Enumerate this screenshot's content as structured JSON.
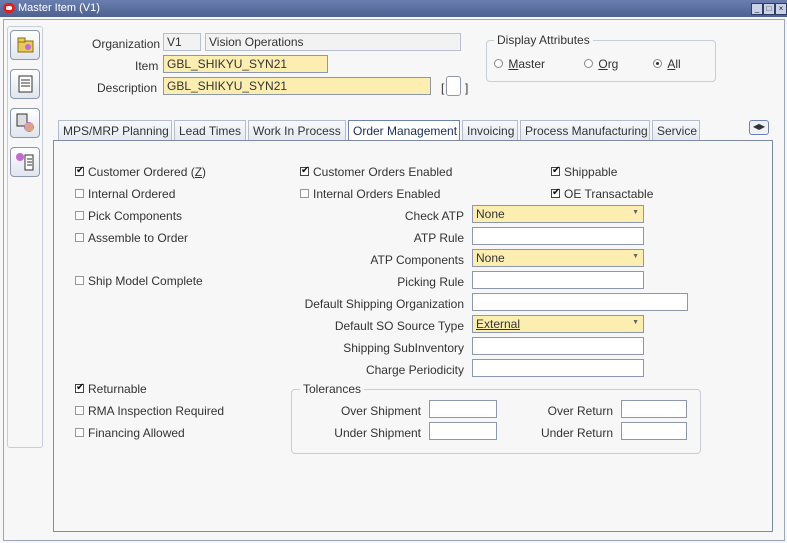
{
  "window": {
    "title": "Master Item (V1)"
  },
  "header": {
    "organization_label": "Organization",
    "organization_code": "V1",
    "organization_name": "Vision Operations",
    "item_label": "Item",
    "item_value": "GBL_SHIKYU_SYN21",
    "description_label": "Description",
    "description_value": "GBL_SHIKYU_SYN21",
    "bracket_field": "[",
    "bracket_close": "]"
  },
  "display_attributes": {
    "title": "Display Attributes",
    "options": [
      "Master",
      "Org",
      "All"
    ],
    "selected": "All"
  },
  "tabs": [
    "MPS/MRP Planning",
    "Lead Times",
    "Work In Process",
    "Order Management",
    "Invoicing",
    "Process Manufacturing",
    "Service"
  ],
  "active_tab": "Order Management",
  "order_management": {
    "customer_ordered": "Customer Ordered (Z)",
    "customer_ordered_pre": "Customer Ordered (",
    "customer_ordered_key": "Z",
    "customer_ordered_post": ")",
    "internal_ordered": "Internal Ordered",
    "pick_components": "Pick Components",
    "assemble_to_order": "Assemble to Order",
    "ship_model_complete": "Ship Model Complete",
    "customer_orders_enabled": "Customer Orders Enabled",
    "internal_orders_enabled": "Internal Orders Enabled",
    "shippable": "Shippable",
    "oe_transactable": "OE Transactable",
    "check_atp_label": "Check ATP",
    "check_atp_value": "None",
    "atp_rule_label": "ATP Rule",
    "atp_rule_value": "",
    "atp_components_label": "ATP Components",
    "atp_components_value": "None",
    "picking_rule_label": "Picking Rule",
    "picking_rule_value": "",
    "default_shipping_org_label": "Default Shipping Organization",
    "default_shipping_org_value": "",
    "default_so_source_type_label": "Default SO Source Type",
    "default_so_source_type_value": "External",
    "shipping_subinventory_label": "Shipping SubInventory",
    "shipping_subinventory_value": "",
    "charge_periodicity_label": "Charge Periodicity",
    "charge_periodicity_value": "",
    "returnable": "Returnable",
    "rma_inspection_required": "RMA Inspection Required",
    "financing_allowed": "Financing Allowed"
  },
  "tolerances": {
    "title": "Tolerances",
    "over_shipment_label": "Over Shipment",
    "under_shipment_label": "Under Shipment",
    "over_return_label": "Over Return",
    "under_return_label": "Under Return"
  }
}
